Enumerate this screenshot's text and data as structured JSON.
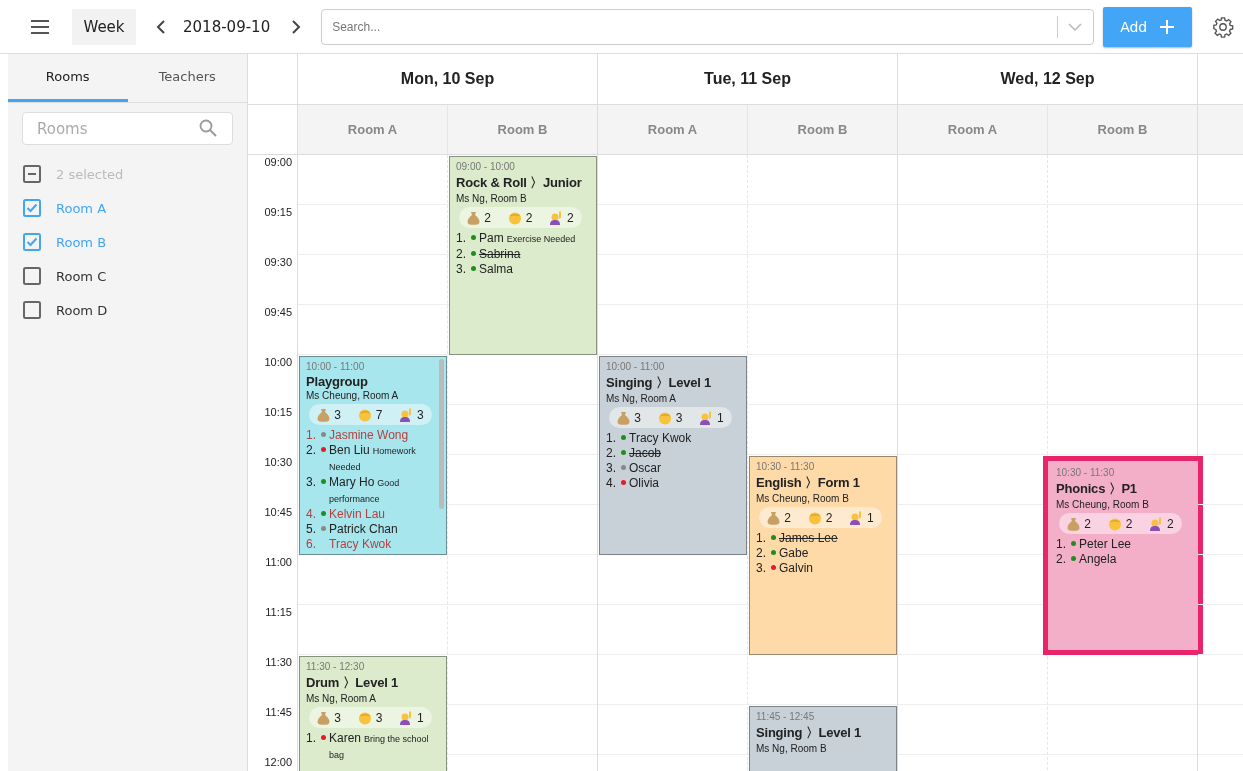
{
  "toolbar": {
    "view_button": "Week",
    "date": "2018-09-10",
    "search": {
      "placeholder": "Search..."
    },
    "add_button": "Add"
  },
  "sidebar": {
    "tabs": [
      {
        "label": "Rooms",
        "selected": true
      },
      {
        "label": "Teachers",
        "selected": false
      }
    ],
    "search": {
      "placeholder": "Rooms"
    },
    "summary": {
      "label": "2 selected",
      "partial": true
    },
    "items": [
      {
        "label": "Room A",
        "checked": true
      },
      {
        "label": "Room B",
        "checked": true
      },
      {
        "label": "Room C",
        "checked": false
      },
      {
        "label": "Room D",
        "checked": false
      }
    ]
  },
  "calendar": {
    "times": [
      "09:00",
      "09:15",
      "09:30",
      "09:45",
      "10:00",
      "10:15",
      "10:30",
      "10:45",
      "11:00",
      "11:15",
      "11:30",
      "11:45",
      "12:00"
    ],
    "days": [
      {
        "label": "Mon, 10 Sep",
        "rooms": [
          {
            "label": "Room A",
            "events": [
              {
                "time": "10:00 - 11:00",
                "title": "Playgroup",
                "teacher": "Ms Cheung, Room A",
                "color": "#a8e6ee",
                "selected": false,
                "scroll": true,
                "stats": [
                  {
                    "kind": "fee",
                    "value": "3"
                  },
                  {
                    "kind": "student",
                    "value": "7"
                  },
                  {
                    "kind": "hand",
                    "value": "3"
                  }
                ],
                "students": [
                  {
                    "number": "1.",
                    "name": "Jasmine Wong",
                    "color": "#888888",
                    "struck": false,
                    "flagged": true
                  },
                  {
                    "number": "2.",
                    "name": "Ben Liu",
                    "note": "Homework Needed",
                    "color": "#e8192c",
                    "struck": false,
                    "flagged": false
                  },
                  {
                    "number": "3.",
                    "name": "Mary Ho",
                    "note": "Good performance",
                    "color": "#1e8f1e",
                    "struck": false,
                    "flagged": false
                  },
                  {
                    "number": "4.",
                    "name": "Kelvin Lau",
                    "color": "#1e8f1e",
                    "struck": false,
                    "flagged": true
                  },
                  {
                    "number": "5.",
                    "name": "Patrick Chan",
                    "color": "#888888",
                    "struck": false,
                    "flagged": false
                  },
                  {
                    "number": "6.",
                    "name": "Tracy Kwok",
                    "struck": false,
                    "flagged": true
                  }
                ]
              },
              {
                "time": "11:30 - 12:30",
                "title": "Drum 〉Level 1",
                "teacher": "Ms Ng, Room A",
                "color": "#dcebcb",
                "selected": false,
                "stats": [
                  {
                    "kind": "fee",
                    "value": "3"
                  },
                  {
                    "kind": "student",
                    "value": "3"
                  },
                  {
                    "kind": "hand",
                    "value": "1"
                  }
                ],
                "students": [
                  {
                    "number": "1.",
                    "name": "Karen",
                    "note": "Bring the school bag",
                    "color": "#e8192c",
                    "struck": false,
                    "flagged": false
                  }
                ]
              }
            ]
          },
          {
            "label": "Room B",
            "events": [
              {
                "time": "09:00 - 10:00",
                "title": "Rock & Roll 〉Junior",
                "teacher": "Ms Ng, Room B",
                "color": "#dcebcb",
                "selected": false,
                "stats": [
                  {
                    "kind": "fee",
                    "value": "2"
                  },
                  {
                    "kind": "student",
                    "value": "2"
                  },
                  {
                    "kind": "hand",
                    "value": "2"
                  }
                ],
                "students": [
                  {
                    "number": "1.",
                    "name": "Pam",
                    "note": "Exercise Needed",
                    "color": "#1e8f1e",
                    "struck": false,
                    "flagged": false
                  },
                  {
                    "number": "2.",
                    "name": "Sabrina",
                    "color": "#1e8f1e",
                    "struck": true,
                    "flagged": false
                  },
                  {
                    "number": "3.",
                    "name": "Salma",
                    "color": "#1e8f1e",
                    "struck": false,
                    "flagged": false
                  }
                ]
              }
            ]
          }
        ]
      },
      {
        "label": "Tue, 11 Sep",
        "rooms": [
          {
            "label": "Room A",
            "events": [
              {
                "time": "10:00 - 11:00",
                "title": "Singing 〉Level 1",
                "teacher": "Ms Ng, Room A",
                "color": "#c8d1d8",
                "selected": false,
                "stats": [
                  {
                    "kind": "fee",
                    "value": "3"
                  },
                  {
                    "kind": "student",
                    "value": "3"
                  },
                  {
                    "kind": "hand",
                    "value": "1"
                  }
                ],
                "students": [
                  {
                    "number": "1.",
                    "name": "Tracy Kwok",
                    "color": "#1e8f1e",
                    "struck": false,
                    "flagged": false
                  },
                  {
                    "number": "2.",
                    "name": "Jacob",
                    "color": "#1e8f1e",
                    "struck": true,
                    "flagged": false
                  },
                  {
                    "number": "3.",
                    "name": "Oscar",
                    "color": "#888888",
                    "struck": false,
                    "flagged": false
                  },
                  {
                    "number": "4.",
                    "name": "Olivia",
                    "color": "#e8192c",
                    "struck": false,
                    "flagged": false
                  }
                ]
              }
            ]
          },
          {
            "label": "Room B",
            "events": [
              {
                "time": "10:30 - 11:30",
                "title": "English 〉Form 1",
                "teacher": "Ms Cheung, Room B",
                "color": "#fddaa8",
                "selected": false,
                "stats": [
                  {
                    "kind": "fee",
                    "value": "2"
                  },
                  {
                    "kind": "student",
                    "value": "2"
                  },
                  {
                    "kind": "hand",
                    "value": "1"
                  }
                ],
                "students": [
                  {
                    "number": "1.",
                    "name": "James Lee",
                    "color": "#1e8f1e",
                    "struck": true,
                    "flagged": false
                  },
                  {
                    "number": "2.",
                    "name": "Gabe",
                    "color": "#1e8f1e",
                    "struck": false,
                    "flagged": false
                  },
                  {
                    "number": "3.",
                    "name": "Galvin",
                    "color": "#e8192c",
                    "struck": false,
                    "flagged": false
                  }
                ]
              },
              {
                "time": "11:45 - 12:45",
                "title": "Singing 〉Level 1",
                "teacher": "Ms Ng, Room B",
                "color": "#c8d1d8",
                "selected": false
              }
            ]
          }
        ]
      },
      {
        "label": "Wed, 12 Sep",
        "rooms": [
          {
            "label": "Room A"
          },
          {
            "label": "Room B",
            "events": [
              {
                "time": "10:30 - 11:30",
                "title": "Phonics 〉P1",
                "teacher": "Ms Cheung, Room B",
                "color": "#f4afc8",
                "selected": true,
                "stats": [
                  {
                    "kind": "fee",
                    "value": "2"
                  },
                  {
                    "kind": "student",
                    "value": "2"
                  },
                  {
                    "kind": "hand",
                    "value": "2"
                  }
                ],
                "students": [
                  {
                    "number": "1.",
                    "name": "Peter Lee",
                    "color": "#1e8f1e",
                    "struck": false,
                    "flagged": false
                  },
                  {
                    "number": "2.",
                    "name": "Angela",
                    "color": "#1e8f1e",
                    "struck": false,
                    "flagged": false
                  }
                ]
              }
            ]
          }
        ]
      }
    ]
  }
}
